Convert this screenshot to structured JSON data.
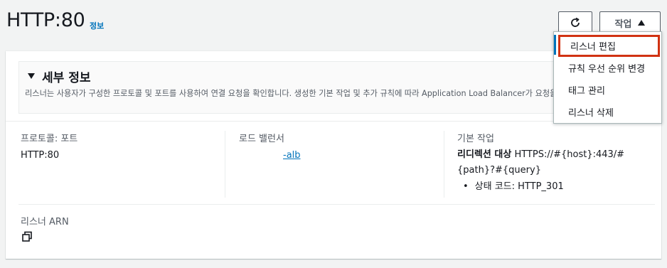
{
  "header": {
    "title": "HTTP:80",
    "info_label": "정보"
  },
  "toolbar": {
    "refresh_icon": "refresh-icon",
    "actions_label": "작업"
  },
  "dropdown": {
    "items": [
      {
        "label": "리스너 편집"
      },
      {
        "label": "규칙 우선 순위 변경"
      },
      {
        "label": "태그 관리"
      },
      {
        "label": "리스너 삭제"
      }
    ]
  },
  "details": {
    "title": "세부 정보",
    "description": "리스너는 사용자가 구성한 프로토콜 및 포트를 사용하여 연결 요청을 확인합니다. 생성한 기본 작업 및 추가 규칙에 따라 Application Load Balancer가 요청을 하는 방법이 결정됩니다."
  },
  "fields": {
    "protocol_port": {
      "label": "프로토콜: 포트",
      "value": "HTTP:80"
    },
    "load_balancer": {
      "label": "로드 밸런서",
      "value": "-alb"
    },
    "default_action": {
      "label": "기본 작업",
      "action_type": "리디렉션 대상",
      "target_line1": "HTTPS://#{host}:443/#",
      "target_line2": "{path}?#{query}",
      "status_code": "상태 코드: HTTP_301"
    },
    "listener_arn": {
      "label": "리스너 ARN"
    }
  },
  "colors": {
    "link": "#0073bb",
    "highlight_border": "#d13212",
    "background": "#f2f3f3"
  }
}
